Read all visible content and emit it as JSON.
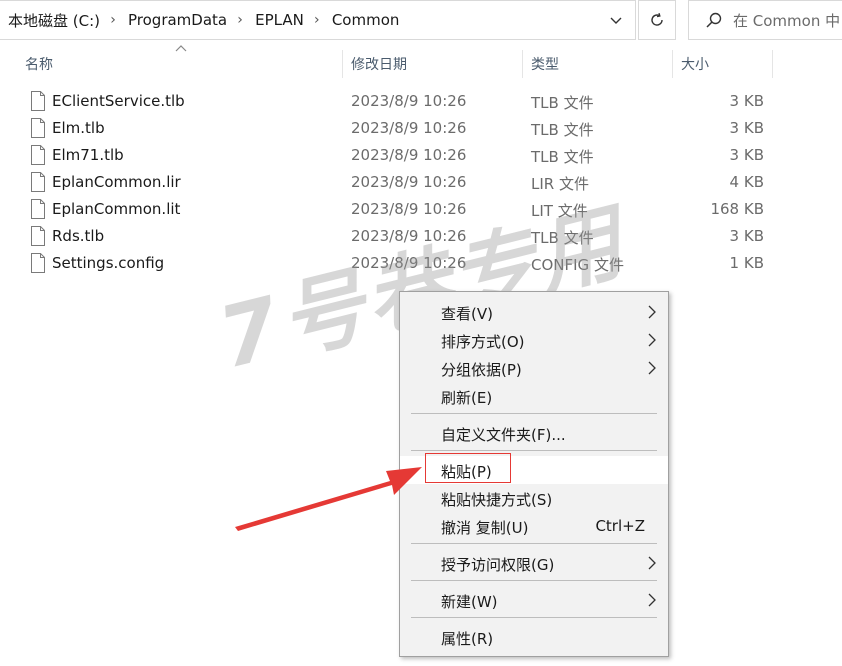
{
  "address_bar": {
    "breadcrumbs": [
      "本地磁盘 (C:)",
      "ProgramData",
      "EPLAN",
      "Common"
    ]
  },
  "search": {
    "placeholder": "在 Common 中"
  },
  "columns": [
    "名称",
    "修改日期",
    "类型",
    "大小"
  ],
  "files": [
    {
      "name": "EClientService.tlb",
      "date": "2023/8/9 10:26",
      "type": "TLB 文件",
      "size": "3 KB"
    },
    {
      "name": "Elm.tlb",
      "date": "2023/8/9 10:26",
      "type": "TLB 文件",
      "size": "3 KB"
    },
    {
      "name": "Elm71.tlb",
      "date": "2023/8/9 10:26",
      "type": "TLB 文件",
      "size": "3 KB"
    },
    {
      "name": "EplanCommon.lir",
      "date": "2023/8/9 10:26",
      "type": "LIR 文件",
      "size": "4 KB"
    },
    {
      "name": "EplanCommon.lit",
      "date": "2023/8/9 10:26",
      "type": "LIT 文件",
      "size": "168 KB"
    },
    {
      "name": "Rds.tlb",
      "date": "2023/8/9 10:26",
      "type": "TLB 文件",
      "size": "3 KB"
    },
    {
      "name": "Settings.config",
      "date": "2023/8/9 10:26",
      "type": "CONFIG 文件",
      "size": "1 KB"
    }
  ],
  "watermark": "7号巷专用",
  "context_menu": {
    "items": [
      {
        "label": "查看(V)",
        "submenu": true
      },
      {
        "label": "排序方式(O)",
        "submenu": true
      },
      {
        "label": "分组依据(P)",
        "submenu": true
      },
      {
        "label": "刷新(E)"
      },
      {
        "label": "自定义文件夹(F)..."
      },
      {
        "label": "粘贴(P)",
        "highlighted": true
      },
      {
        "label": "粘贴快捷方式(S)"
      },
      {
        "label": "撤消 复制(U)",
        "shortcut": "Ctrl+Z"
      },
      {
        "label": "授予访问权限(G)",
        "submenu": true
      },
      {
        "label": "新建(W)",
        "submenu": true
      },
      {
        "label": "属性(R)"
      }
    ]
  },
  "colors": {
    "highlight_box": "#e53935",
    "annotation_arrow": "#e53935"
  },
  "icons": {
    "file": "file-icon",
    "refresh": "refresh-icon",
    "search": "search-icon",
    "dropdown": "chevron-down-icon",
    "submenu": "chevron-right-icon"
  }
}
